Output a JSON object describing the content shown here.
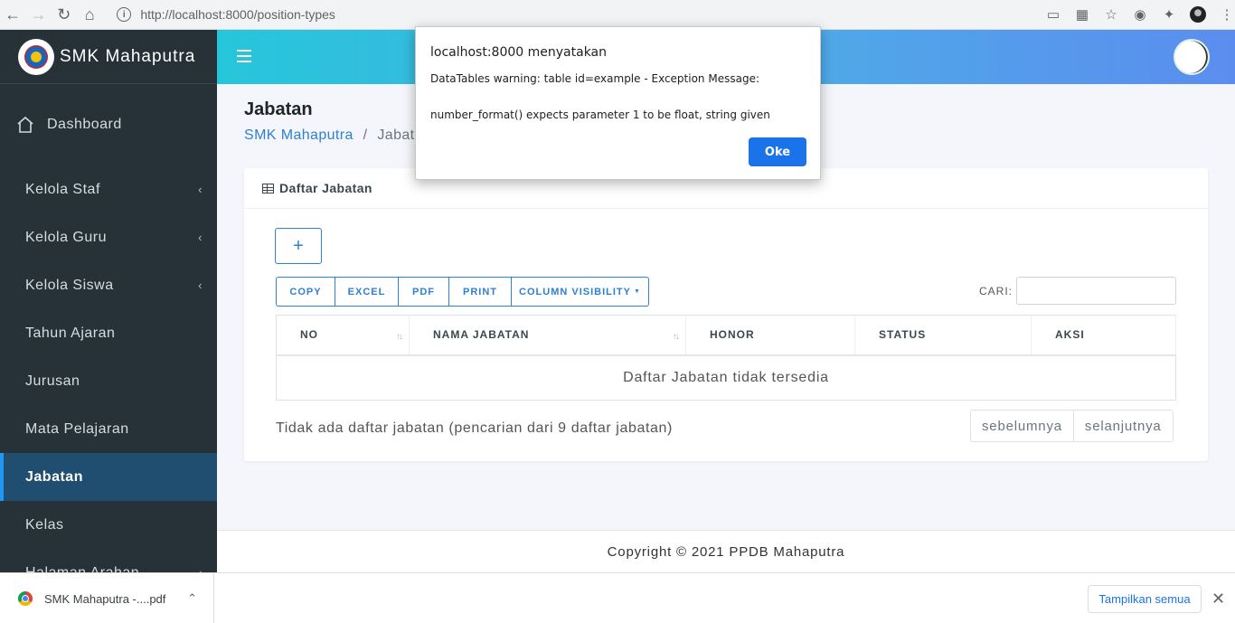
{
  "browser": {
    "url": "http://localhost:8000/position-types"
  },
  "sidebar": {
    "brand": "SMK Mahaputra",
    "items": [
      {
        "label": "Dashboard"
      },
      {
        "label": "Kelola Staf"
      },
      {
        "label": "Kelola Guru"
      },
      {
        "label": "Kelola Siswa"
      },
      {
        "label": "Tahun Ajaran"
      },
      {
        "label": "Jurusan"
      },
      {
        "label": "Mata Pelajaran"
      },
      {
        "label": "Jabatan"
      },
      {
        "label": "Kelas"
      },
      {
        "label": "Halaman Arahan"
      }
    ]
  },
  "page": {
    "title": "Jabatan",
    "breadcrumb_home": "SMK Mahaputra",
    "breadcrumb_sep": "/",
    "breadcrumb_current": "Jabatan"
  },
  "card": {
    "title": "Daftar Jabatan",
    "add_label": "+",
    "buttons": [
      "COPY",
      "EXCEL",
      "PDF",
      "PRINT",
      "COLUMN VISIBILITY"
    ],
    "search_label": "CARI:",
    "columns": [
      "NO",
      "NAMA JABATAN",
      "HONOR",
      "STATUS",
      "AKSI"
    ],
    "empty_message": "Daftar Jabatan tidak tersedia",
    "info": "Tidak ada daftar jabatan (pencarian dari 9 daftar jabatan)",
    "prev": "sebelumnya",
    "next": "selanjutnya"
  },
  "footer": {
    "text": "Copyright © 2021 PPDB Mahaputra"
  },
  "download_bar": {
    "file": "SMK Mahaputra -....pdf",
    "show_all": "Tampilkan semua"
  },
  "dialog": {
    "title": "localhost:8000 menyatakan",
    "message_line1": "DataTables warning: table id=example - Exception Message:",
    "message_line2": "number_format() expects parameter 1 to be float, string given",
    "ok": "Oke"
  },
  "colors": {
    "sidebar_bg": "#263238",
    "active_item_bg": "#1f4e70",
    "accent": "#2f80d1",
    "dialog_button": "#1a73e8"
  }
}
